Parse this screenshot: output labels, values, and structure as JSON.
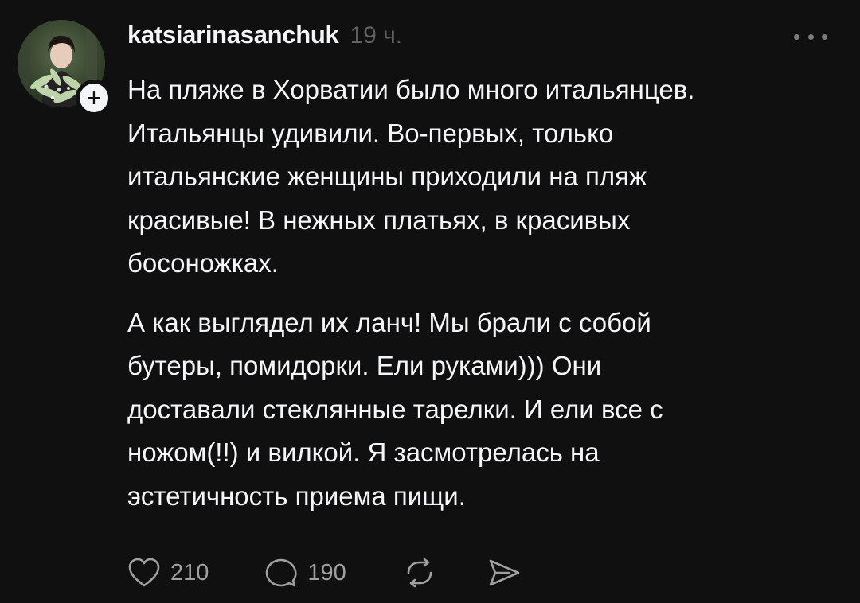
{
  "post": {
    "username": "katsiarinasanchuk",
    "timestamp": "19 ч.",
    "paragraphs": [
      [
        "На пляже в Хорватии было много  итальянцев.",
        "Итальянцы удивили. Во-первых, только",
        "итальянские женщины приходили на пляж",
        "красивые!  В нежных платьях, в красивых",
        "босоножках."
      ],
      [
        "А как выглядел их ланч! Мы брали с собой",
        "бутеры, помидорки.  Ели руками))) Они",
        "доставали стеклянные тарелки. И ели все с",
        "ножом(!!) и вилкой. Я засмотрелась на",
        "эстетичность приема пищи."
      ]
    ],
    "actions": {
      "like_count": "210",
      "reply_count": "190"
    },
    "icons": {
      "more": "more-horizontal-icon",
      "follow": "plus-icon",
      "like": "heart-icon",
      "reply": "comment-icon",
      "repost": "repost-icon",
      "share": "send-icon"
    },
    "colors": {
      "background": "#101010",
      "text": "#f3f5f7",
      "muted": "#616161",
      "icon": "#a0a0a0"
    }
  }
}
